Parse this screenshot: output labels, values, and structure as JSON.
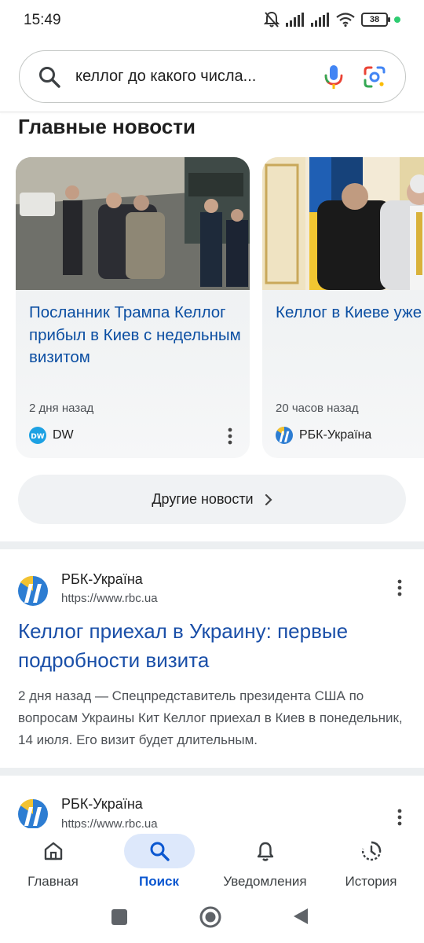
{
  "status_bar": {
    "time": "15:49",
    "battery": "38"
  },
  "search": {
    "query": "келлог до какого числа..."
  },
  "top_stories": {
    "title": "Главные новости",
    "cards": [
      {
        "title": "Посланник Трампа Келлог прибыл в Киев с недельным визитом",
        "time": "2 дня назад",
        "source": "DW"
      },
      {
        "title": "Келлог в Киеве уже второй день: с кем и о чем говорил",
        "time": "20 часов назад",
        "source": "РБК-Україна"
      }
    ],
    "more_button": "Другие новости"
  },
  "results": [
    {
      "site_name": "РБК-Україна",
      "url": "https://www.rbc.ua",
      "title": "Келлог приехал в Украину: первые подробности визита",
      "snippet": "2 дня назад — Спецпредставитель президента США по вопросам Украины Кит Келлог приехал в Киев в понедельник, 14 июля. Его визит будет длительным."
    },
    {
      "site_name": "РБК-Україна",
      "url": "https://www.rbc.ua"
    }
  ],
  "bottom_nav": {
    "items": [
      {
        "label": "Главная",
        "icon": "home-icon"
      },
      {
        "label": "Поиск",
        "icon": "search-icon",
        "active": true
      },
      {
        "label": "Уведомления",
        "icon": "bell-icon"
      },
      {
        "label": "История",
        "icon": "history-icon"
      }
    ]
  },
  "colors": {
    "link_blue": "#1a4fa8",
    "accent": "#0b57d0",
    "active_pill": "#dde8fb"
  }
}
